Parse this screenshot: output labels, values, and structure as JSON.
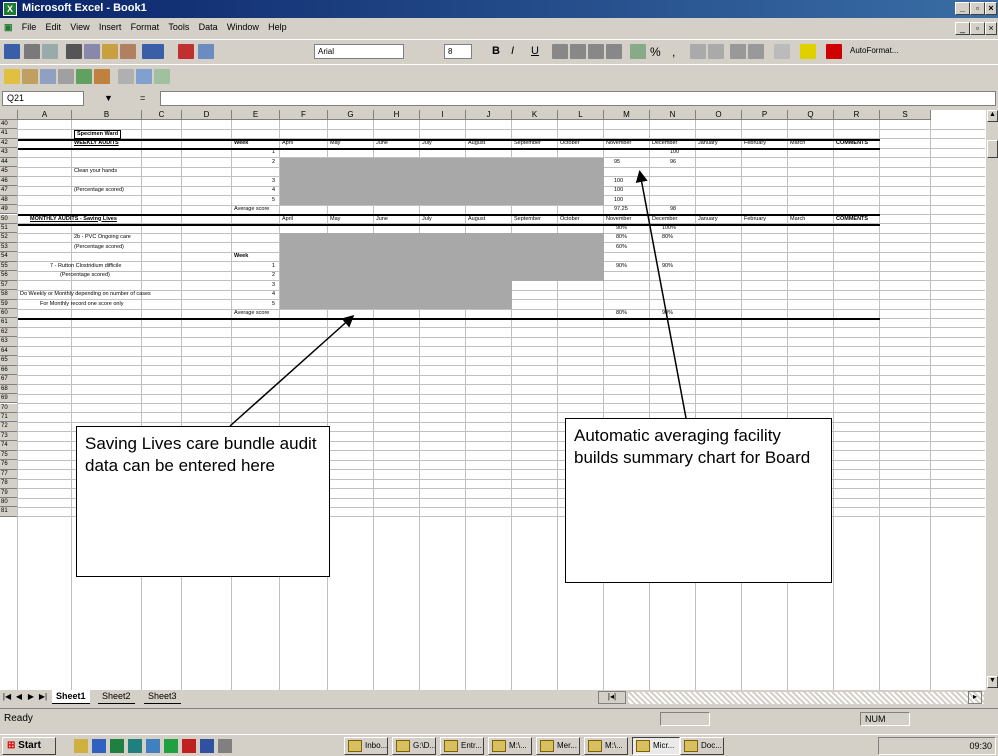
{
  "window": {
    "title": "Microsoft Excel - Book1"
  },
  "menu": [
    "File",
    "Edit",
    "View",
    "Insert",
    "Format",
    "Tools",
    "Data",
    "Window",
    "Help"
  ],
  "toolbar": {
    "font": "Arial",
    "size": "8",
    "autoformat": "AutoFormat..."
  },
  "formula": {
    "cell_ref": "Q21"
  },
  "columns": [
    "A",
    "B",
    "C",
    "D",
    "E",
    "F",
    "G",
    "H",
    "I",
    "J",
    "K",
    "L",
    "M",
    "N",
    "O",
    "P",
    "Q",
    "R",
    "S"
  ],
  "rows": [
    "40",
    "41",
    "42",
    "43",
    "44",
    "45",
    "46",
    "47",
    "48",
    "49",
    "50",
    "51",
    "52",
    "53",
    "54",
    "55",
    "56",
    "57",
    "58",
    "59",
    "60",
    "61",
    "62",
    "63",
    "64",
    "65",
    "66",
    "67",
    "68",
    "69",
    "70",
    "71",
    "72",
    "73",
    "74",
    "75",
    "76",
    "77",
    "78",
    "79",
    "80",
    "81"
  ],
  "sheet": {
    "ward_title": "Specimen Ward",
    "weekly_heading": "WEEKLY AUDITS",
    "week_label": "Week",
    "months": [
      "April",
      "May",
      "June",
      "July",
      "August",
      "September",
      "October",
      "November",
      "December",
      "January",
      "February",
      "March"
    ],
    "comments": "COMMENTS",
    "weekly_item": "Clean your hands",
    "weekly_sub": "(Percentage scored)",
    "weeks": [
      "1",
      "2",
      "3",
      "4",
      "5"
    ],
    "weekly_values": {
      "nov": [
        "95",
        "100",
        "100",
        "100"
      ],
      "dec": [
        "100",
        "96"
      ]
    },
    "average_label": "Average score",
    "weekly_avg": {
      "nov": "97.25",
      "dec": "98"
    },
    "monthly_heading": "MONTHLY AUDITS - Saving Lives",
    "monthly_item1": "2b - PVC Ongoing care",
    "monthly_sub1": "(Percentage scored)",
    "monthly1_values": {
      "nov": [
        "90%",
        "80%",
        "60%"
      ],
      "dec": [
        "100%",
        "80%"
      ]
    },
    "monthly_item2": "7 - Rutton Clostridium difficile",
    "monthly_sub2": "(Percentage scored)",
    "monthly2_values": {
      "nov": "90%",
      "dec": "90%"
    },
    "note1": "Do Weekly or Monthly depending on number of cases",
    "note2": "For Monthly record one score only",
    "monthly_avg": {
      "nov": "80%",
      "dec": "90%"
    }
  },
  "callouts": {
    "left": "Saving Lives care bundle audit data can be entered here",
    "right": "Automatic averaging facility builds summary chart for Board"
  },
  "tabs": [
    "Sheet1",
    "Sheet2",
    "Sheet3"
  ],
  "status": {
    "ready": "Ready",
    "num": "NUM"
  },
  "taskbar": {
    "start": "Start",
    "tasks": [
      "Inbo...",
      "G:\\D...",
      "Entr...",
      "M:\\...",
      "Mer...",
      "M:\\...",
      "Micr...",
      "Doc..."
    ],
    "clock": "09:30"
  }
}
